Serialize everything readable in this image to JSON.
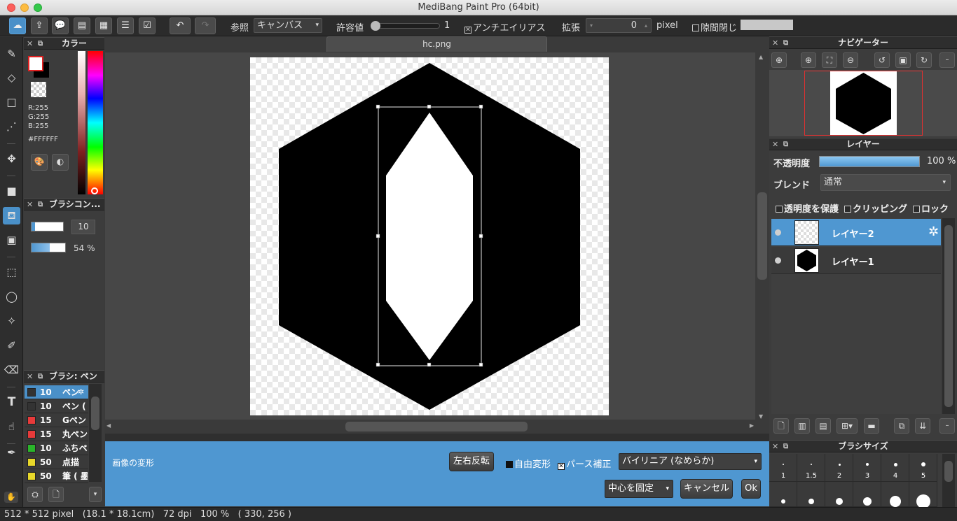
{
  "app": {
    "title": "MediBang Paint Pro (64bit)"
  },
  "toolbar": {
    "ref_label": "参照",
    "ref_value": "キャンバス",
    "tolerance_label": "許容値",
    "tolerance_value": "1",
    "antialias_label": "アンチエイリアス",
    "expand_label": "拡張",
    "expand_value": "0",
    "expand_unit": "pixel",
    "gap_close_label": "隙間閉じ"
  },
  "color_panel": {
    "title": "カラー",
    "r": "R:255",
    "g": "G:255",
    "b": "B:255",
    "hex": "#FFFFFF"
  },
  "brush_control_panel": {
    "title": "ブラシコン...",
    "size_value": "10",
    "opacity_value": "54 %",
    "opacity_fraction": 0.54
  },
  "brush_panel": {
    "title": "ブラシ: ペン",
    "items": [
      {
        "size": "10",
        "name": "ペン",
        "color": "#333333",
        "selected": true
      },
      {
        "size": "10",
        "name": "ペン (",
        "color": "#333333"
      },
      {
        "size": "15",
        "name": "Gペン",
        "color": "#e83a3a"
      },
      {
        "size": "15",
        "name": "丸ペン",
        "color": "#e83a3a"
      },
      {
        "size": "10",
        "name": "ふちペ",
        "color": "#2ab52a"
      },
      {
        "size": "50",
        "name": "点描",
        "color": "#e8d82a"
      },
      {
        "size": "50",
        "name": "筆 ( 墨",
        "color": "#e8d82a"
      }
    ]
  },
  "document": {
    "tab": "hc.png"
  },
  "transform_bar": {
    "title": "画像の変形",
    "flip_label": "左右反転",
    "free_transform_label": "自由変形",
    "perspective_label": "パース補正",
    "interpolation_value": "バイリニア (なめらか)",
    "anchor_value": "中心を固定",
    "cancel_label": "キャンセル",
    "ok_label": "Ok"
  },
  "navigator": {
    "title": "ナビゲーター"
  },
  "layer_panel": {
    "title": "レイヤー",
    "opacity_label": "不透明度",
    "opacity_value": "100 %",
    "blend_label": "ブレンド",
    "blend_value": "通常",
    "protect_alpha_label": "透明度を保護",
    "clipping_label": "クリッピング",
    "lock_label": "ロック",
    "layers": [
      {
        "name": "レイヤー2",
        "selected": true
      },
      {
        "name": "レイヤー1"
      }
    ]
  },
  "brush_size_panel": {
    "title": "ブラシサイズ",
    "sizes": [
      "1",
      "1.5",
      "2",
      "3",
      "4",
      "5"
    ]
  },
  "status": {
    "dimensions": "512 * 512 pixel",
    "physical": "(18.1 * 18.1cm)",
    "dpi": "72 dpi",
    "zoom": "100 %",
    "coords": "( 330, 256 )"
  }
}
